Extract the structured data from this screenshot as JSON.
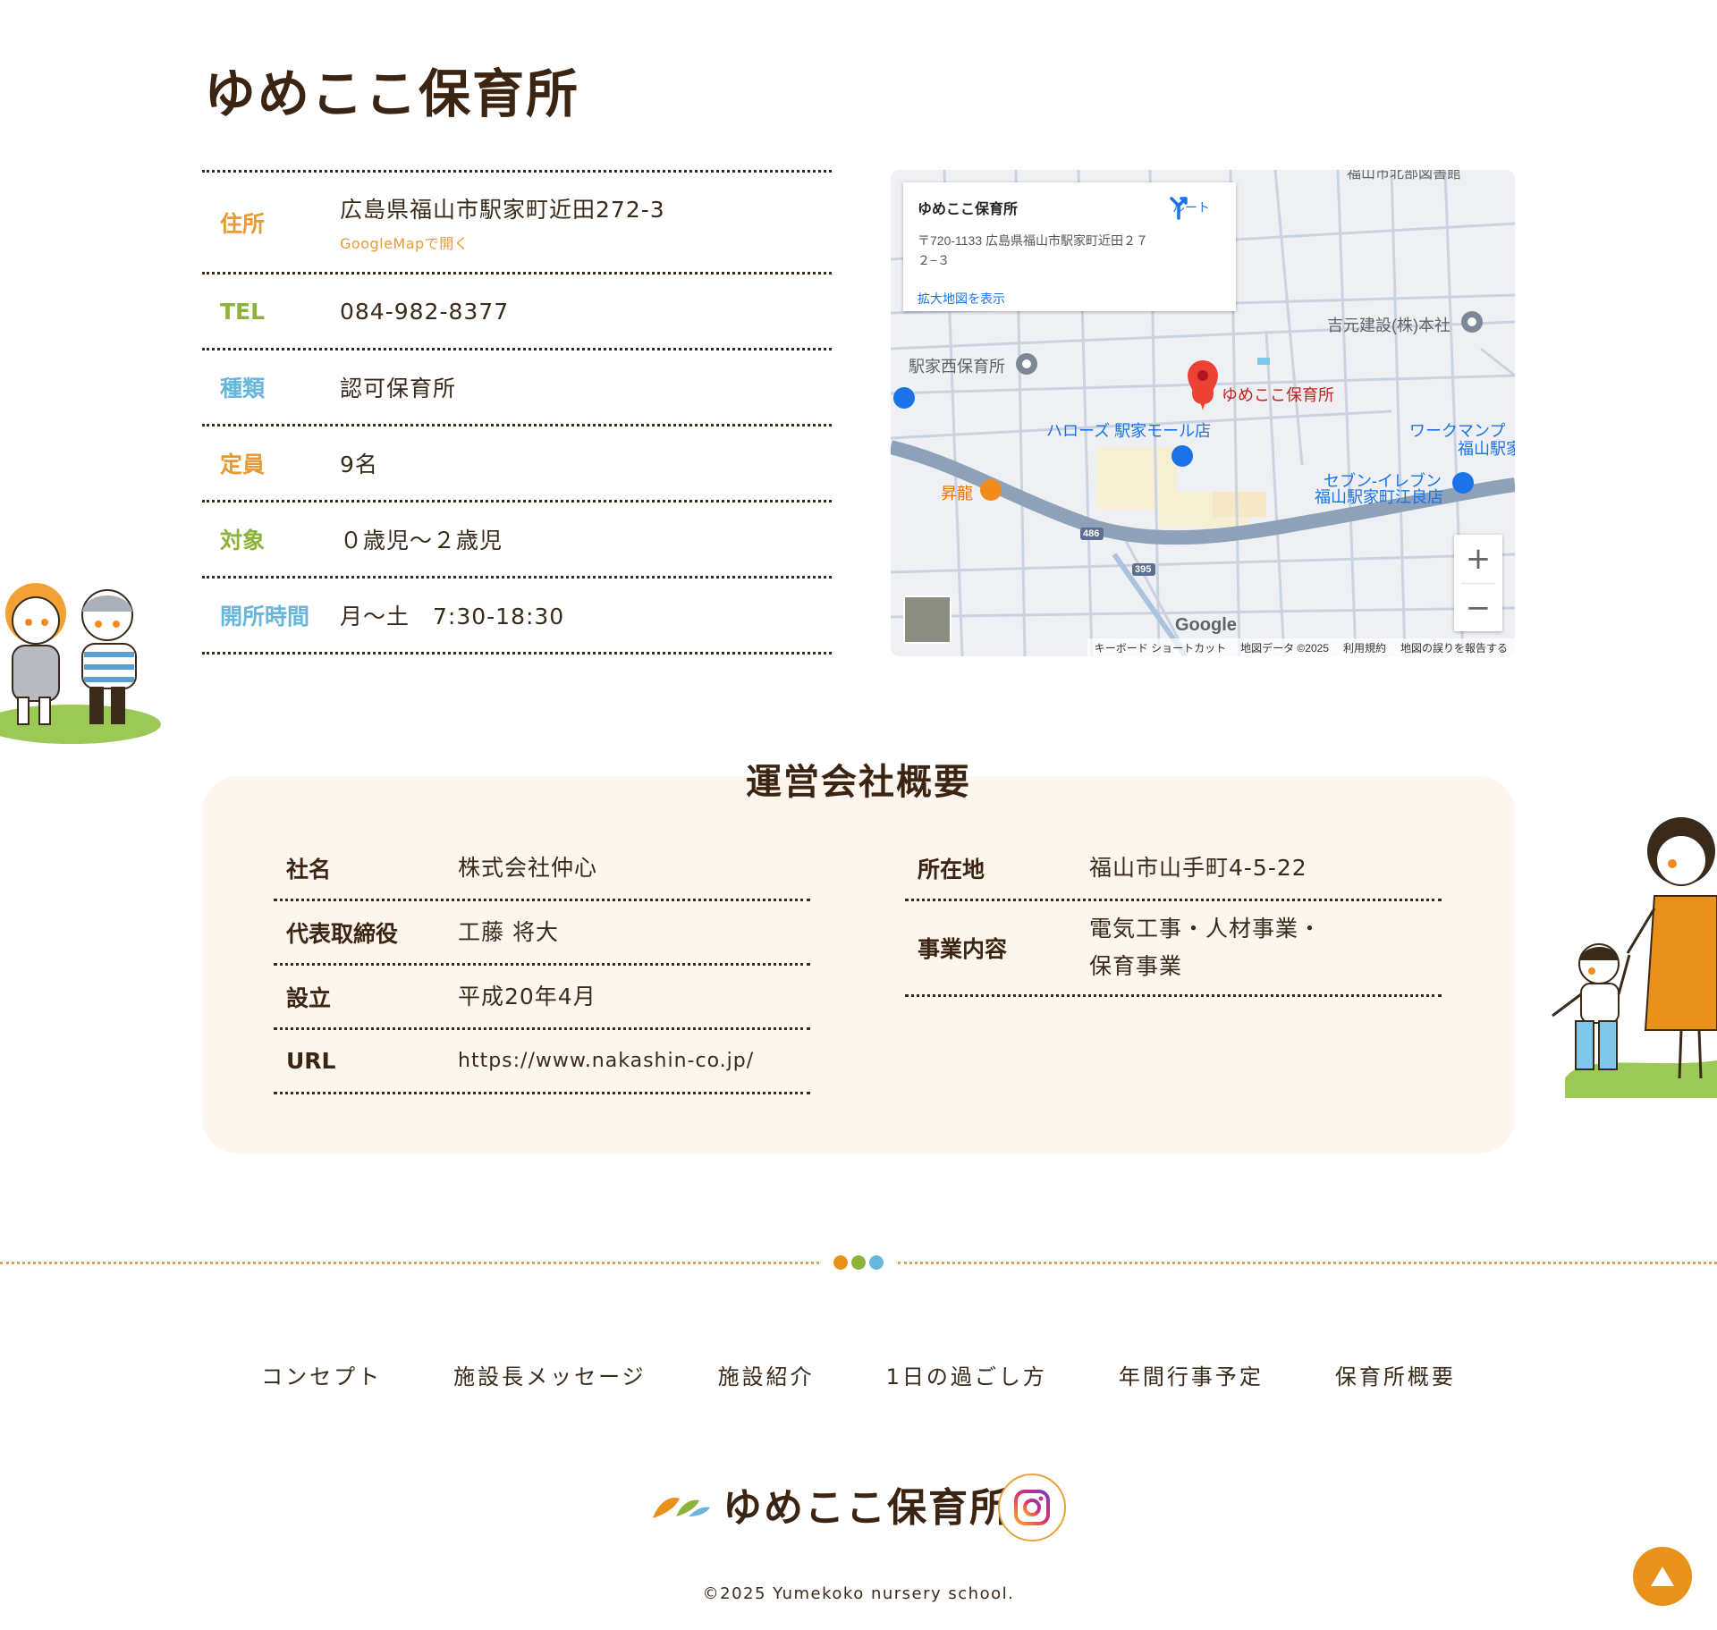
{
  "page": {
    "title": "ゆめここ保育所"
  },
  "info": {
    "rows": [
      {
        "label": "住所",
        "label_color": "#e79a36",
        "value": "広島県福山市駅家町近田272-3",
        "sub": "GoogleMapで開く"
      },
      {
        "label": "TEL",
        "label_color": "#8db33a",
        "value": "084-982-8377"
      },
      {
        "label": "種類",
        "label_color": "#68b6d9",
        "value": "認可保育所"
      },
      {
        "label": "定員",
        "label_color": "#e79a36",
        "value": "9名"
      },
      {
        "label": "対象",
        "label_color": "#8db33a",
        "value": "０歳児～２歳児"
      },
      {
        "label": "開所時間",
        "label_color": "#68b6d9",
        "value": "月～土　7:30-18:30"
      }
    ]
  },
  "map": {
    "card": {
      "title": "ゆめここ保育所",
      "address": "〒720-1133 広島県福山市駅家町近田２７２−３",
      "link": "拡大地図を表示",
      "route": "ルート"
    },
    "labels": {
      "pin": "ゆめここ保育所",
      "west_nursery": "駅家西保育所",
      "yoshimoto": "吉元建設(株)本社",
      "halows": "ハローズ 駅家モール店",
      "workman_1": "ワークマンプ",
      "workman_2": "福山駅家",
      "seven_1": "セブン-イレブン",
      "seven_2": "福山駅家町江良店",
      "shoryu": "昇龍",
      "road_486": "486",
      "road_395": "395",
      "top_cut": "福山市北部図書館"
    },
    "google": "Google",
    "footer": [
      "キーボード ショートカット",
      "地図データ ©2025",
      "利用規約",
      "地図の誤りを報告する"
    ],
    "zoom_in": "+",
    "zoom_out": "−"
  },
  "company": {
    "title": "運営会社概要",
    "left": [
      {
        "label": "社名",
        "value": "株式会社仲心"
      },
      {
        "label": "代表取締役",
        "value": "工藤 将大"
      },
      {
        "label": "設立",
        "value": "平成20年4月"
      },
      {
        "label": "URL",
        "value": "https://www.nakashin-co.jp/"
      }
    ],
    "right": [
      {
        "label": "所在地",
        "value": "福山市山手町4-5-22"
      },
      {
        "label": "事業内容",
        "value_line1": "電気工事・人材事業・",
        "value_line2": "保育事業"
      }
    ]
  },
  "divider_colors": [
    "#e8911b",
    "#8db33a",
    "#68b6d9"
  ],
  "footer": {
    "nav": [
      "コンセプト",
      "施設長メッセージ",
      "施設紹介",
      "1日の過ごし方",
      "年間行事予定",
      "保育所概要"
    ],
    "logo_text": "ゆめここ保育所",
    "copyright": "©2025 Yumekoko nursery school."
  },
  "icons": {
    "instagram": "instagram-icon",
    "to_top": "triangle-up-icon"
  }
}
